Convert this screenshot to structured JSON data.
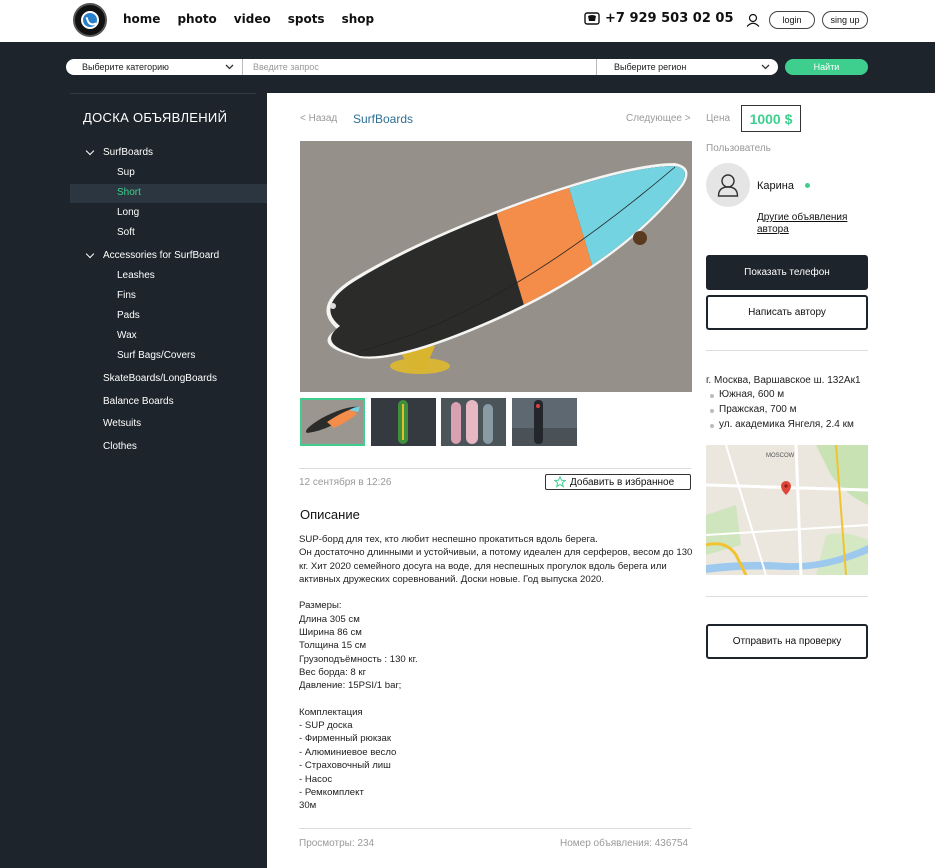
{
  "header": {
    "nav": [
      "home",
      "photo",
      "video",
      "spots",
      "shop"
    ],
    "phone": "+7 929 503 02 05",
    "login_label": "login",
    "signup_label": "sing up"
  },
  "search": {
    "category_label": "Выберите категорию",
    "query_placeholder": "Введите запрос",
    "region_label": "Выберите регион",
    "find_label": "Найти"
  },
  "sidebar": {
    "title": "ДОСКА ОБЪЯВЛЕНИЙ",
    "groups": [
      {
        "label": "SurfBoards",
        "children": [
          "Sup",
          "Short",
          "Long",
          "Soft"
        ]
      },
      {
        "label": "Accessories for SurfBoard",
        "children": [
          "Leashes",
          "Fins",
          "Pads",
          "Wax",
          "Surf Bags/Covers"
        ]
      }
    ],
    "items": [
      "SkateBoards/LongBoards",
      "Balance Boards",
      "Wetsuits",
      "Clothes"
    ],
    "active": "Short"
  },
  "listing": {
    "back_label": "< Назад",
    "breadcrumb": "SurfBoards",
    "next_label": "Следующее >",
    "price_label": "Цена",
    "price": "1000 $",
    "date": "12 сентября в 12:26",
    "favorite_label": "Добавить в избранное",
    "description_title": "Описание",
    "description_intro": "SUP-борд для тех, кто любит неспешно прокатиться вдоль берега.\nОн достаточно длинными и устойчивыи, а потому идеален для серферов, весом до 130 кг. Хит 2020 семейного досуга на воде, для неспешных прогулок вдоль берега или активных дружеских соревнований. Доски новые. Год выпуска 2020.",
    "sizes": "Размеры:\nДлина 305 см\nШирина 86 см\nТолщина 15 см\nГрузоподъёмность : 130 кг.\nВес борда: 8 кг\nДавление: 15PSI/1 bar;",
    "kit": "Комплектация\n- SUP доска\n- Фирменный рюкзак\n- Алюминиевое весло\n- Страховочный лиш\n- Насос\n- Ремкомплект\n30м",
    "views": "Просмотры: 234",
    "ad_number": "Номер объявления: 436754"
  },
  "seller": {
    "label": "Пользователь",
    "name": "Карина",
    "other_ads": "Другие объявления автора",
    "show_phone": "Показать телефон",
    "write_author": "Написать автору",
    "address": "г. Москва, Варшавское ш. 132Ак1",
    "metro": [
      "Южная, 600 м",
      "Пражская, 700 м",
      "ул. академика Янгеля, 2.4 км"
    ],
    "report": "Отправить на проверку",
    "map_label": "MOSCOW"
  },
  "colors": {
    "accent": "#3ecf8e",
    "dark": "#1d242b",
    "link": "#2f6f95"
  }
}
